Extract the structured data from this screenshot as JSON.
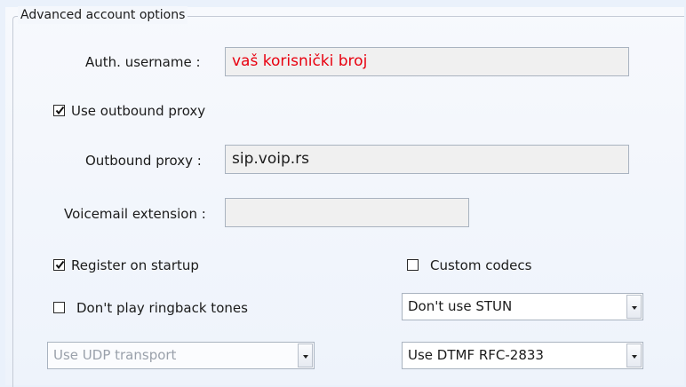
{
  "group": {
    "title": "Advanced account options"
  },
  "auth": {
    "label": "Auth. username :",
    "value": "vaš korisnički broj",
    "value_color": "#e8000f"
  },
  "outbound_proxy_check": {
    "label": "Use outbound proxy",
    "checked": true
  },
  "outbound_proxy": {
    "label": "Outbound proxy :",
    "value": "sip.voip.rs"
  },
  "voicemail": {
    "label": "Voicemail extension :",
    "value": ""
  },
  "register_startup": {
    "label": "Register on startup",
    "checked": true
  },
  "custom_codecs": {
    "label": "Custom codecs",
    "checked": false
  },
  "ringback": {
    "label": "Don't play ringback tones",
    "checked": false
  },
  "stun_select": {
    "value": "Don't use STUN"
  },
  "transport_select": {
    "value": "Use UDP transport",
    "enabled": false
  },
  "dtmf_select": {
    "value": "Use DTMF RFC-2833"
  },
  "icons": {
    "check": "check-mark-icon",
    "dropdown": "chevron-down-icon"
  }
}
